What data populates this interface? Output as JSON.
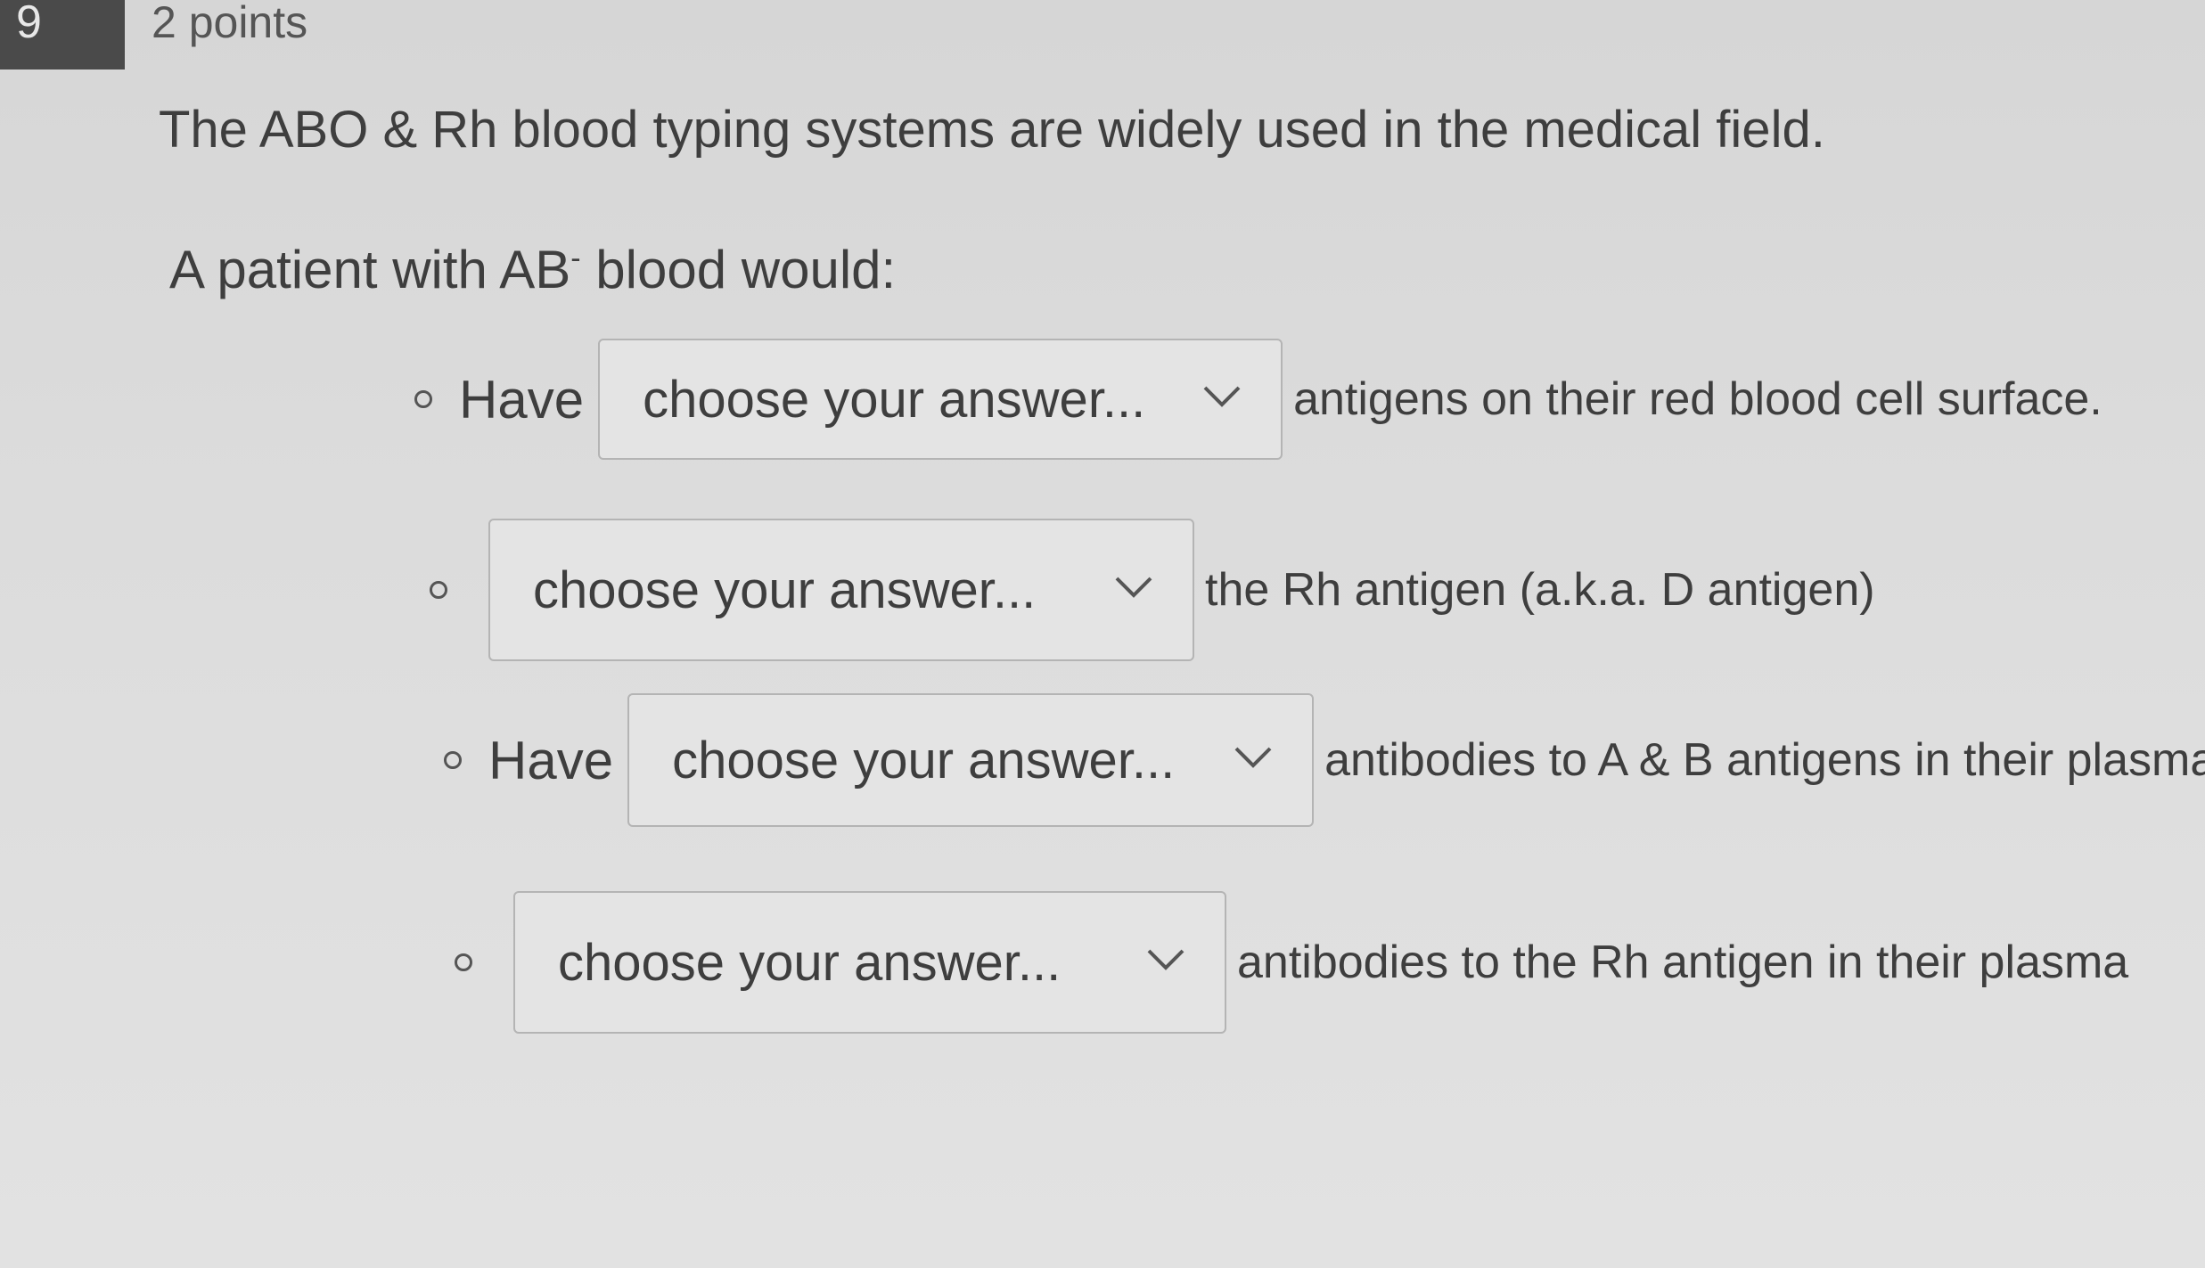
{
  "question": {
    "number": "9",
    "points": "2 points",
    "prompt": "The ABO & Rh blood typing systems are widely used in the medical field.",
    "lead_text": "A patient with AB",
    "lead_superscript": "-",
    "lead_suffix": "blood would:"
  },
  "items": [
    {
      "prefix": "Have",
      "select_value": "choose your answer...",
      "suffix": "antigens on their red blood cell surface."
    },
    {
      "prefix": "",
      "select_value": "choose your answer...",
      "suffix": "the Rh antigen (a.k.a. D antigen)"
    },
    {
      "prefix": "Have",
      "select_value": "choose your answer...",
      "suffix": "antibodies to A & B antigens in their plasma"
    },
    {
      "prefix": "",
      "select_value": "choose your answer...",
      "suffix": "antibodies to the Rh antigen in their plasma"
    }
  ],
  "icons": {
    "bullet": "hollow-circle-icon",
    "dropdown": "chevron-down-icon"
  }
}
